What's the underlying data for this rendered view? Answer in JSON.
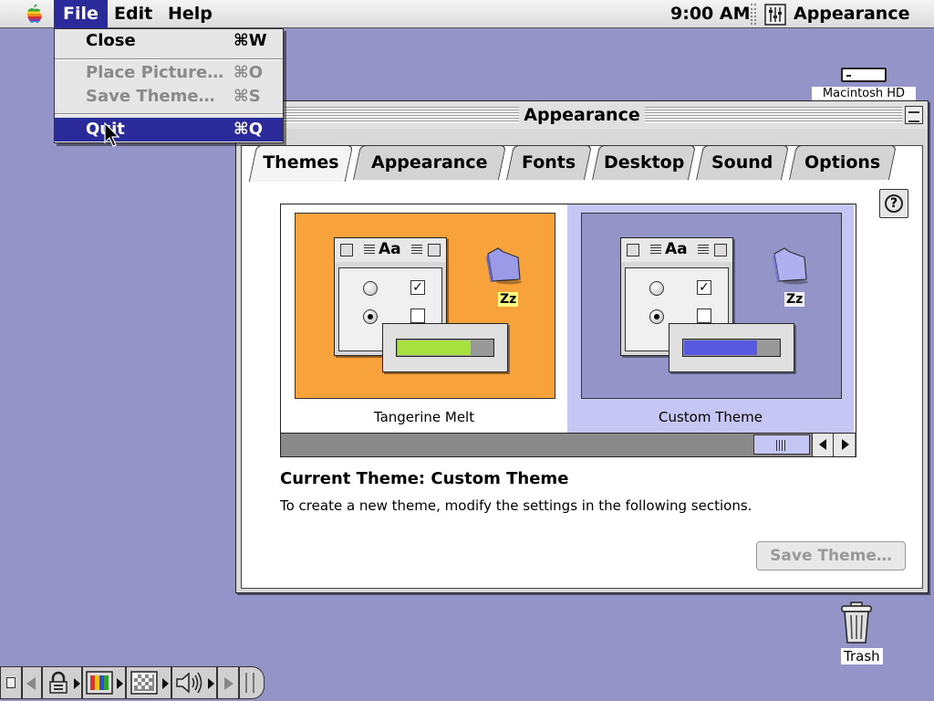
{
  "menubar": {
    "menus": [
      "File",
      "Edit",
      "Help"
    ],
    "clock": "9:00 AM",
    "app_name": "Appearance"
  },
  "file_menu": {
    "items": [
      {
        "label": "Close",
        "shortcut": "⌘W",
        "enabled": true
      },
      {
        "label": "Place Picture…",
        "shortcut": "⌘O",
        "enabled": false
      },
      {
        "label": "Save Theme…",
        "shortcut": "⌘S",
        "enabled": false
      },
      {
        "label": "Quit",
        "shortcut": "⌘Q",
        "enabled": true,
        "highlighted": true
      }
    ]
  },
  "desktop": {
    "hd_label": "Macintosh HD",
    "trash_label": "Trash"
  },
  "window": {
    "title": "Appearance",
    "tabs": [
      "Themes",
      "Appearance",
      "Fonts",
      "Desktop",
      "Sound",
      "Options"
    ],
    "active_tab": "Themes",
    "help_glyph": "?",
    "themes": [
      {
        "name": "Tangerine Melt",
        "bg": "#f7a23a",
        "accent": "#a8e040",
        "zz_bg": "#ffff80",
        "selected": false
      },
      {
        "name": "Custom Theme",
        "bg": "#9494c8",
        "accent": "#5858e0",
        "zz_bg": "#f0f0f0",
        "selected": true
      }
    ],
    "mini_aa": "Aa",
    "zz": "Zz",
    "current_theme": "Current Theme: Custom Theme",
    "description": "To create a new theme, modify the settings in the following sections.",
    "save_button": "Save Theme…"
  }
}
